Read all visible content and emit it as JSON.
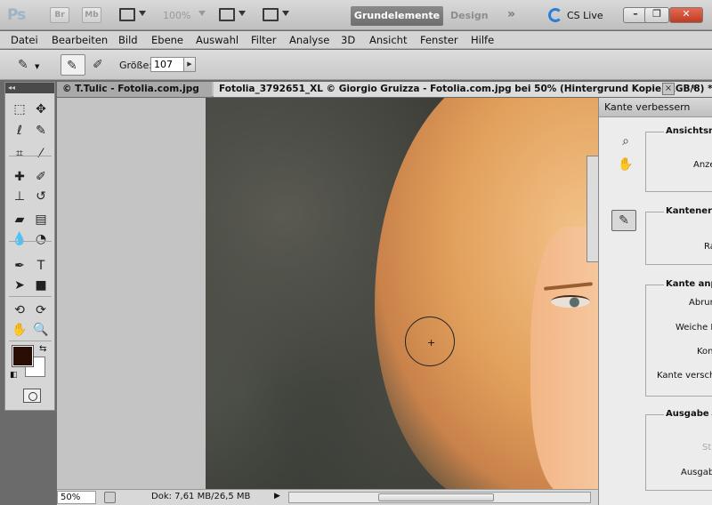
{
  "appbar": {
    "logo": "Ps",
    "br_label": "Br",
    "mb_label": "Mb",
    "zoom": "100%",
    "workspace_active": "Grundelemente",
    "workspace_other": "Design",
    "more": "»",
    "cs_live": "CS Live",
    "win_minimize": "–",
    "win_restore": "❐",
    "win_close": "✕"
  },
  "menu": [
    "Datei",
    "Bearbeiten",
    "Bild",
    "Ebene",
    "Auswahl",
    "Filter",
    "Analyse",
    "3D",
    "Ansicht",
    "Fenster",
    "Hilfe"
  ],
  "options": {
    "size_label": "Größe:",
    "size_value": "107"
  },
  "tabs": {
    "tab1": "© T.Tulic - Fotolia.com.jpg",
    "tab2": "Fotolia_3792651_XL © Giorgio Gruizza - Fotolia.com.jpg bei 50% (Hintergrund Kopie, RGB/8) *",
    "close": "×",
    "more": "»"
  },
  "tools_header": "◂◂",
  "tools": [
    {
      "name": "rectangle-marquee-icon",
      "glyph": "⬚"
    },
    {
      "name": "move-tool-icon",
      "glyph": "✥"
    },
    {
      "name": "lasso-icon",
      "glyph": "ℓ"
    },
    {
      "name": "quick-selection-icon",
      "glyph": "✎"
    },
    {
      "name": "crop-icon",
      "glyph": "⌗"
    },
    {
      "name": "eyedropper-icon",
      "glyph": "⁄"
    },
    {
      "name": "healing-brush-icon",
      "glyph": "✚"
    },
    {
      "name": "brush-icon",
      "glyph": "✐"
    },
    {
      "name": "clone-stamp-icon",
      "glyph": "⊥"
    },
    {
      "name": "history-brush-icon",
      "glyph": "↺"
    },
    {
      "name": "eraser-icon",
      "glyph": "▰"
    },
    {
      "name": "gradient-icon",
      "glyph": "▤"
    },
    {
      "name": "blur-icon",
      "glyph": "💧"
    },
    {
      "name": "dodge-icon",
      "glyph": "◔"
    },
    {
      "name": "pen-icon",
      "glyph": "✒"
    },
    {
      "name": "type-icon",
      "glyph": "T"
    },
    {
      "name": "path-selection-icon",
      "glyph": "➤"
    },
    {
      "name": "shape-icon",
      "glyph": "■"
    },
    {
      "name": "3d-rotate-icon",
      "glyph": "⟲"
    },
    {
      "name": "3d-orbit-icon",
      "glyph": "⟳"
    },
    {
      "name": "hand-icon",
      "glyph": "✋"
    },
    {
      "name": "zoom-icon",
      "glyph": "🔍"
    }
  ],
  "colors": {
    "foreground": "#2a0e05",
    "background": "#ffffff"
  },
  "status": {
    "zoom": "50%",
    "doc_info": "Dok: 7,61 MB/26,5 MB",
    "arrow": "▶"
  },
  "dialog": {
    "title": "Kante verbessern",
    "groups": {
      "view": "Ansichtsmo",
      "view_label": "Anze",
      "edge_detect": "Kantenerke",
      "edge_detect_label": "Ra",
      "adjust": "Kante anpa",
      "adjust_labels": [
        "Abrun",
        "Weiche K",
        "Kon",
        "Kante versch"
      ],
      "output": "Ausgabe",
      "output_labels": [
        "St",
        "Ausgab"
      ]
    }
  }
}
